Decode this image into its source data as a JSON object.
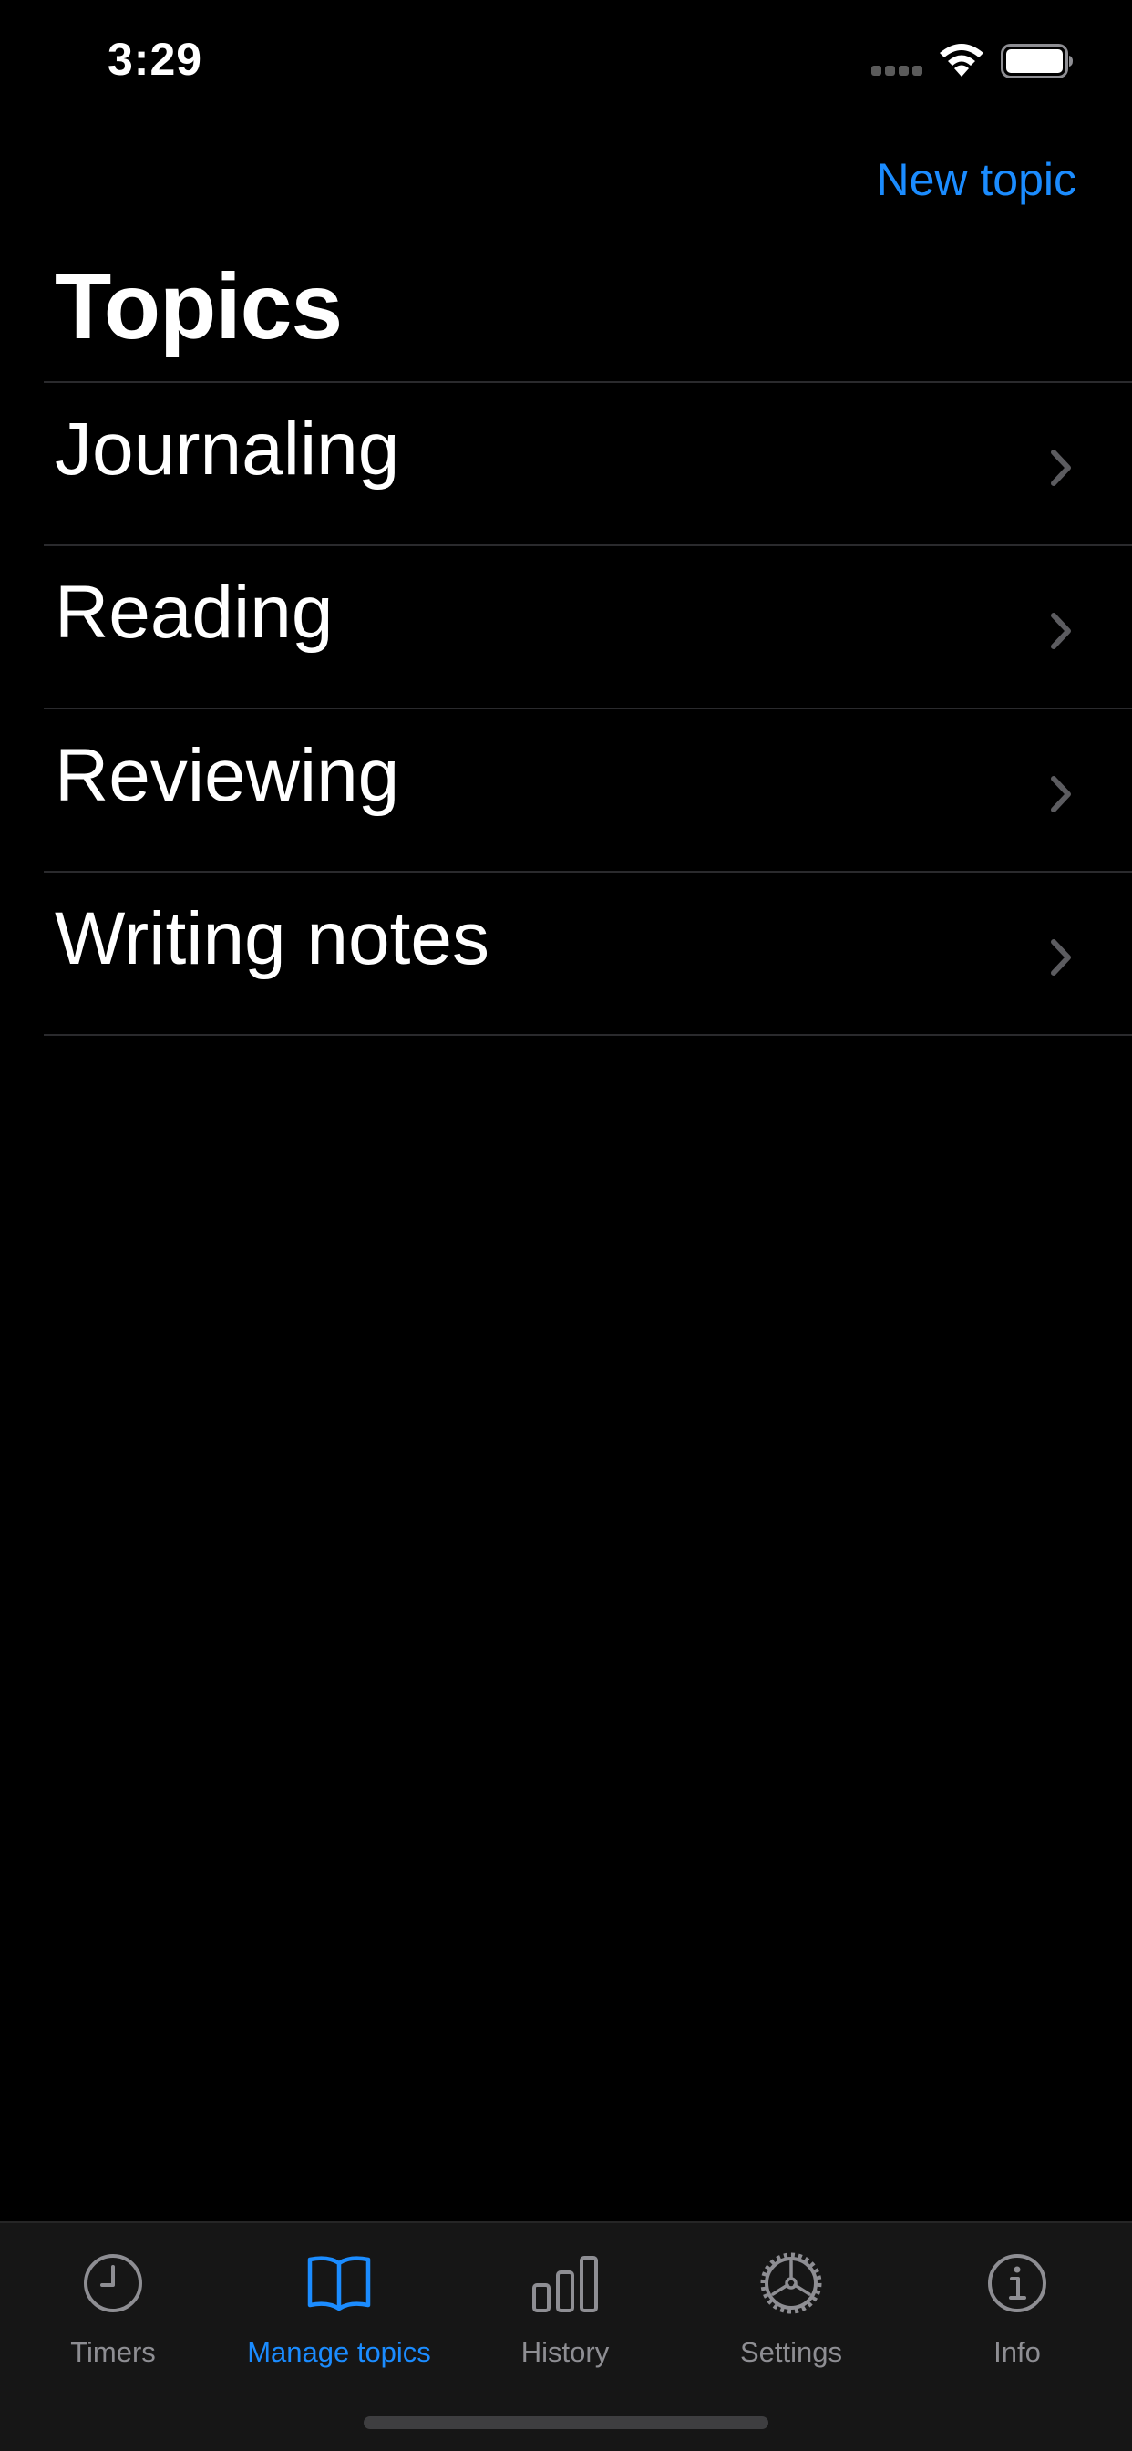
{
  "status_bar": {
    "time": "3:29"
  },
  "nav": {
    "new_topic_label": "New topic",
    "title": "Topics"
  },
  "topics": [
    {
      "label": "Journaling"
    },
    {
      "label": "Reading"
    },
    {
      "label": "Reviewing"
    },
    {
      "label": "Writing notes"
    }
  ],
  "tab_bar": {
    "tabs": [
      {
        "label": "Timers",
        "icon": "clock-icon"
      },
      {
        "label": "Manage topics",
        "icon": "book-icon"
      },
      {
        "label": "History",
        "icon": "bar-chart-icon"
      },
      {
        "label": "Settings",
        "icon": "gear-icon"
      },
      {
        "label": "Info",
        "icon": "info-icon"
      }
    ],
    "active_tab": "Manage topics"
  },
  "colors": {
    "accent": "#1b8cff",
    "background": "#000000",
    "tab_bar_bg": "#161616",
    "inactive": "#8e8e93",
    "separator": "#2a2a2d"
  }
}
